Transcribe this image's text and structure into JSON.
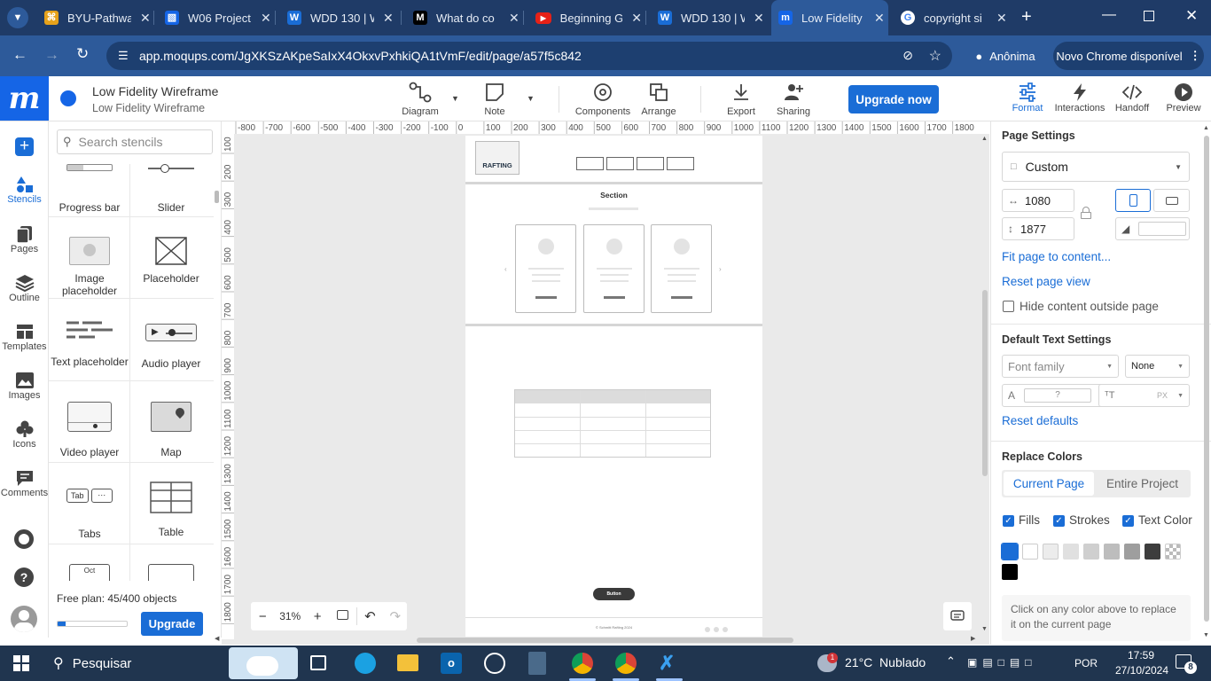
{
  "browser": {
    "tabs": [
      {
        "title": "BYU-Pathway"
      },
      {
        "title": "W06 Project"
      },
      {
        "title": "WDD 130 | W"
      },
      {
        "title": "What do co"
      },
      {
        "title": "Beginning G"
      },
      {
        "title": "WDD 130 | W"
      },
      {
        "title": "Low Fidelity"
      },
      {
        "title": "copyright si"
      }
    ],
    "url": "app.moqups.com/JgXKSzAKpeSaIxX4OkxvPxhkiQA1tVmF/edit/page/a57f5c842",
    "profile_label": "Anônima",
    "update_label": "Novo Chrome disponível"
  },
  "app": {
    "logo": "m",
    "project_title": "Low Fidelity Wireframe",
    "page_title": "Low Fidelity Wireframe",
    "toolbar": {
      "diagram": "Diagram",
      "note": "Note",
      "components": "Components",
      "arrange": "Arrange",
      "export": "Export",
      "sharing": "Sharing",
      "upgrade_now": "Upgrade now"
    },
    "right_tools": {
      "format": "Format",
      "interactions": "Interactions",
      "handoff": "Handoff",
      "preview": "Preview"
    }
  },
  "rail": {
    "stencils": "Stencils",
    "pages": "Pages",
    "outline": "Outline",
    "templates": "Templates",
    "images": "Images",
    "icons": "Icons",
    "comments": "Comments"
  },
  "stencils": {
    "search_placeholder": "Search stencils",
    "items": [
      {
        "label": "Progress bar"
      },
      {
        "label": "Slider"
      },
      {
        "label": "Image placeholder"
      },
      {
        "label": "Placeholder"
      },
      {
        "label": "Text placeholder"
      },
      {
        "label": "Audio player"
      },
      {
        "label": "Video player"
      },
      {
        "label": "Map"
      },
      {
        "label": "Tabs"
      },
      {
        "label": "Table"
      }
    ],
    "tabs_icon_text": "Tab",
    "calendar_icon_text": "Oct",
    "plan_text": "Free plan: 45/400 objects",
    "plan_usage_fraction": 0.1125,
    "upgrade_button": "Upgrade"
  },
  "canvas": {
    "ruler_h": [
      "-800",
      "-700",
      "-600",
      "-500",
      "-400",
      "-300",
      "-200",
      "-100",
      "0",
      "100",
      "200",
      "300",
      "400",
      "500",
      "600",
      "700",
      "800",
      "900",
      "1000",
      "1100",
      "1200",
      "1300",
      "1400",
      "1500",
      "1600",
      "1700",
      "1800"
    ],
    "ruler_v": [
      "100",
      "200",
      "300",
      "400",
      "500",
      "600",
      "700",
      "800",
      "900",
      "1000",
      "1100",
      "1200",
      "1300",
      "1400",
      "1500",
      "1600",
      "1700",
      "1800"
    ],
    "zoom": "31%",
    "wireframe": {
      "logo_text": "RAFTING",
      "section_title": "Section",
      "button_text": "Button",
      "footer_text": "© Schmitt Rafting 2024"
    }
  },
  "format_panel": {
    "page_settings": "Page Settings",
    "page_preset": "Custom",
    "width": "1080",
    "height": "1877",
    "fit_page": "Fit page to content...",
    "reset_view": "Reset page view",
    "hide_outside": "Hide content outside page",
    "default_text": "Default Text Settings",
    "font_family": "Font family",
    "font_weight": "None",
    "font_color_placeholder": "?",
    "font_size_unit": "PX",
    "reset_defaults": "Reset defaults",
    "replace_colors": "Replace Colors",
    "current_page": "Current Page",
    "entire_project": "Entire Project",
    "fills": "Fills",
    "strokes": "Strokes",
    "text_color": "Text Color",
    "swatches": [
      "#1a6dd6",
      "#ffffff",
      "#ececec",
      "#e0e0e0",
      "#cfcfcf",
      "#bdbdbd",
      "#9e9e9e",
      "#3d3d3d",
      "transparent",
      "#000000"
    ],
    "hint": "Click on any color above to replace it on the current page"
  },
  "taskbar": {
    "search": "Pesquisar",
    "weather": "21°C  Nublado",
    "weather_badge": "1",
    "lang": "POR",
    "time": "17:59",
    "date": "27/10/2024",
    "notif": "8"
  }
}
